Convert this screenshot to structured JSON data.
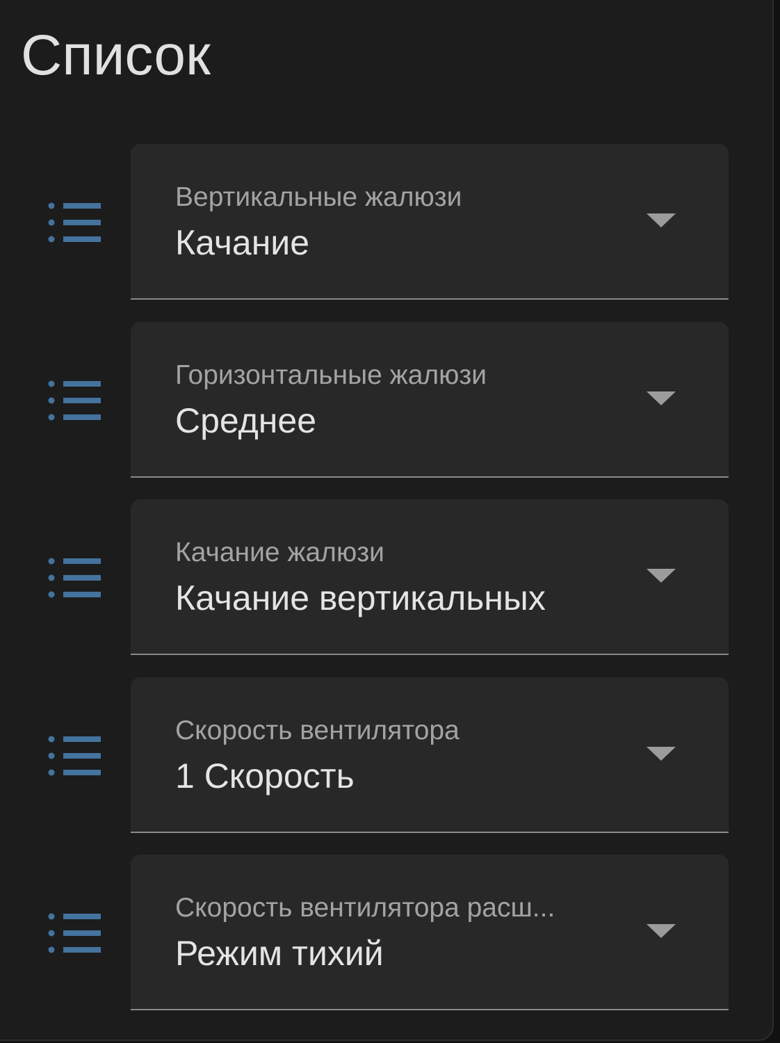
{
  "card": {
    "title": "Список"
  },
  "entities": [
    {
      "label": "Вертикальные жалюзи",
      "value": "Качание",
      "icon": "format-list-bulleted-icon"
    },
    {
      "label": "Горизонтальные жалюзи",
      "value": "Среднее",
      "icon": "format-list-bulleted-icon"
    },
    {
      "label": "Качание жалюзи",
      "value": "Качание вертикальных",
      "icon": "format-list-bulleted-icon"
    },
    {
      "label": "Скорость вентилятора",
      "value": "1 Скорость",
      "icon": "format-list-bulleted-icon"
    },
    {
      "label": "Скорость вентилятора расш...",
      "value": "Режим тихий",
      "icon": "format-list-bulleted-icon"
    }
  ],
  "colors": {
    "background": "#1c1c1c",
    "select_fill": "#282828",
    "icon": "#44739e",
    "label": "#a3a3a3",
    "value": "#e4e4e4"
  }
}
